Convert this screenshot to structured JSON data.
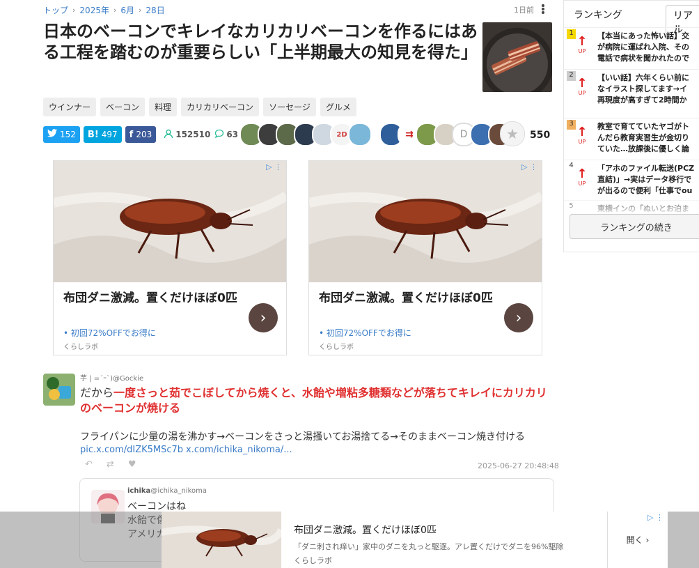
{
  "breadcrumb": [
    "トップ",
    "2025年",
    "6月",
    "28日"
  ],
  "age": "1日前",
  "title": "日本のベーコンでキレイなカリカリベーコンを作るにはある工程を踏むのが重要らしい「上半期最大の知見を得た」",
  "tags": [
    "ウインナー",
    "ベーコン",
    "料理",
    "カリカリベーコン",
    "ソーセージ",
    "グルメ"
  ],
  "shares": {
    "twitter": "152",
    "hatena": "497",
    "facebook": "203",
    "views": "152510",
    "comments": "63",
    "favorites": "550"
  },
  "ads": [
    {
      "headline": "布団ダニ激減。置くだけほぼ0匹",
      "sub": "初回72%OFFでお得に",
      "brand": "くらしラボ"
    },
    {
      "headline": "布団ダニ激減。置くだけほぼ0匹",
      "sub": "初回72%OFFでお得に",
      "brand": "くらしラボ"
    }
  ],
  "tweet": {
    "user": "芋 | =´ｰ`)@Gockie",
    "lead": "だから",
    "highlight": "一度さっと茹でこぼしてから焼くと、水飴や増粘多糖類などが落ちてキレイにカリカリのベーコンが焼ける",
    "body": "フライパンに少量の湯を沸かす→ベーコンをさっと湯掻いてお湯捨てる→そのままベーコン焼き付ける",
    "link1": "pic.x.com/dIZK5MSc7b",
    "link2": "x.com/ichika_nikoma/...",
    "date": "2025-06-27 20:48:48"
  },
  "reply": {
    "name": "ichika",
    "handle": "@ichika_nikoma",
    "lines": [
      "ベーコンはね",
      "水飴で傷",
      "アメリカ"
    ]
  },
  "ranking": {
    "tab_active": "ランキング",
    "tab_other": "リアル",
    "items": [
      {
        "rank": "1",
        "line1": "【本当にあった怖い話】交",
        "line2": "が病院に運ばれ入院、その",
        "line3": "電話で病状を聞かれたので"
      },
      {
        "rank": "2",
        "line1": "【いい話】六年くらい前に",
        "line2": "なイラスト探してます→イ",
        "line3": "再現度が高すぎて2時間か"
      },
      {
        "rank": "3",
        "line1": "教室で育てていたヤゴがト",
        "line2": "んだら教育実習生が金切り",
        "line3": "ていた…放課後に優しく論"
      },
      {
        "rank": "4",
        "line1": "「アホのファイル転送(PCZ",
        "line2": "直結)」→実はデータ移行で",
        "line3": "が出るので便利「仕事でou"
      },
      {
        "rank": "5",
        "line1": "東横インの「ぬいとお泊ま",
        "line2": "",
        "line3": ""
      }
    ],
    "up_label": "UP",
    "more": "ランキングの続き"
  },
  "bottom_ad": {
    "headline": "布団ダニ激減。置くだけほぼ0匹",
    "desc": "「ダニ刺され痒い」家中のダニを丸っと駆逐。アレ置くだけでダニを96%駆除",
    "brand": "くらしラボ",
    "cta": "開く"
  }
}
